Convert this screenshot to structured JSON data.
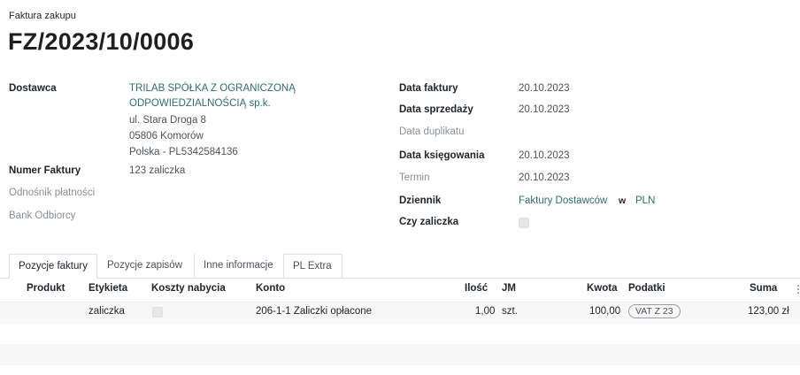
{
  "header": {
    "doc_type": "Faktura zakupu",
    "number": "FZ/2023/10/0006"
  },
  "left": {
    "supplier_label": "Dostawca",
    "supplier_name_1": "TRILAB SPÓŁKA Z OGRANICZONĄ",
    "supplier_name_2": "ODPOWIEDZIALNOŚCIĄ sp.k.",
    "address_1": "ul. Stara Droga 8",
    "address_2": "05806 Komorów",
    "address_3": "Polska - PL5342584136",
    "invoice_no_label": "Numer Faktury",
    "invoice_no_value": "123 zaliczka",
    "payment_ref_label": "Odnośnik płatności",
    "bank_label": "Bank Odbiorcy"
  },
  "right": {
    "invoice_date_label": "Data faktury",
    "invoice_date": "20.10.2023",
    "sale_date_label": "Data sprzedaży",
    "sale_date": "20.10.2023",
    "duplicate_date_label": "Data duplikatu",
    "accounting_date_label": "Data księgowania",
    "accounting_date": "20.10.2023",
    "term_label": "Termin",
    "term": "20.10.2023",
    "journal_label": "Dziennik",
    "journal": "Faktury Dostawców",
    "journal_in": "w",
    "currency": "PLN",
    "advance_label": "Czy zaliczka"
  },
  "tabs": [
    "Pozycje faktury",
    "Pozycje zapisów",
    "Inne informacje",
    "PL Extra"
  ],
  "table": {
    "columns": {
      "product": "Produkt",
      "label": "Etykieta",
      "cost": "Koszty nabycia",
      "account": "Konto",
      "qty": "Ilość",
      "uom": "JM",
      "amount": "Kwota",
      "taxes": "Podatki",
      "total": "Suma"
    },
    "rows": [
      {
        "label": "zaliczka",
        "account": "206-1-1 Zaliczki opłacone",
        "qty": "1,00",
        "uom": "szt.",
        "amount": "100,00",
        "tax": "VAT Z 23",
        "total": "123,00 zł"
      }
    ]
  },
  "icons": {
    "columns_menu": "column-settings-icon"
  }
}
